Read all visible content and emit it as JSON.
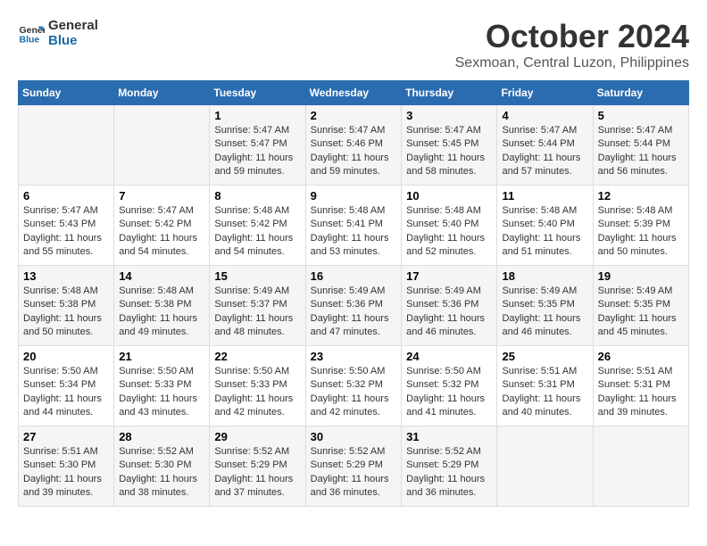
{
  "logo": {
    "line1": "General",
    "line2": "Blue"
  },
  "title": "October 2024",
  "subtitle": "Sexmoan, Central Luzon, Philippines",
  "weekdays": [
    "Sunday",
    "Monday",
    "Tuesday",
    "Wednesday",
    "Thursday",
    "Friday",
    "Saturday"
  ],
  "weeks": [
    [
      {
        "day": "",
        "sunrise": "",
        "sunset": "",
        "daylight": ""
      },
      {
        "day": "",
        "sunrise": "",
        "sunset": "",
        "daylight": ""
      },
      {
        "day": "1",
        "sunrise": "Sunrise: 5:47 AM",
        "sunset": "Sunset: 5:47 PM",
        "daylight": "Daylight: 11 hours and 59 minutes."
      },
      {
        "day": "2",
        "sunrise": "Sunrise: 5:47 AM",
        "sunset": "Sunset: 5:46 PM",
        "daylight": "Daylight: 11 hours and 59 minutes."
      },
      {
        "day": "3",
        "sunrise": "Sunrise: 5:47 AM",
        "sunset": "Sunset: 5:45 PM",
        "daylight": "Daylight: 11 hours and 58 minutes."
      },
      {
        "day": "4",
        "sunrise": "Sunrise: 5:47 AM",
        "sunset": "Sunset: 5:44 PM",
        "daylight": "Daylight: 11 hours and 57 minutes."
      },
      {
        "day": "5",
        "sunrise": "Sunrise: 5:47 AM",
        "sunset": "Sunset: 5:44 PM",
        "daylight": "Daylight: 11 hours and 56 minutes."
      }
    ],
    [
      {
        "day": "6",
        "sunrise": "Sunrise: 5:47 AM",
        "sunset": "Sunset: 5:43 PM",
        "daylight": "Daylight: 11 hours and 55 minutes."
      },
      {
        "day": "7",
        "sunrise": "Sunrise: 5:47 AM",
        "sunset": "Sunset: 5:42 PM",
        "daylight": "Daylight: 11 hours and 54 minutes."
      },
      {
        "day": "8",
        "sunrise": "Sunrise: 5:48 AM",
        "sunset": "Sunset: 5:42 PM",
        "daylight": "Daylight: 11 hours and 54 minutes."
      },
      {
        "day": "9",
        "sunrise": "Sunrise: 5:48 AM",
        "sunset": "Sunset: 5:41 PM",
        "daylight": "Daylight: 11 hours and 53 minutes."
      },
      {
        "day": "10",
        "sunrise": "Sunrise: 5:48 AM",
        "sunset": "Sunset: 5:40 PM",
        "daylight": "Daylight: 11 hours and 52 minutes."
      },
      {
        "day": "11",
        "sunrise": "Sunrise: 5:48 AM",
        "sunset": "Sunset: 5:40 PM",
        "daylight": "Daylight: 11 hours and 51 minutes."
      },
      {
        "day": "12",
        "sunrise": "Sunrise: 5:48 AM",
        "sunset": "Sunset: 5:39 PM",
        "daylight": "Daylight: 11 hours and 50 minutes."
      }
    ],
    [
      {
        "day": "13",
        "sunrise": "Sunrise: 5:48 AM",
        "sunset": "Sunset: 5:38 PM",
        "daylight": "Daylight: 11 hours and 50 minutes."
      },
      {
        "day": "14",
        "sunrise": "Sunrise: 5:48 AM",
        "sunset": "Sunset: 5:38 PM",
        "daylight": "Daylight: 11 hours and 49 minutes."
      },
      {
        "day": "15",
        "sunrise": "Sunrise: 5:49 AM",
        "sunset": "Sunset: 5:37 PM",
        "daylight": "Daylight: 11 hours and 48 minutes."
      },
      {
        "day": "16",
        "sunrise": "Sunrise: 5:49 AM",
        "sunset": "Sunset: 5:36 PM",
        "daylight": "Daylight: 11 hours and 47 minutes."
      },
      {
        "day": "17",
        "sunrise": "Sunrise: 5:49 AM",
        "sunset": "Sunset: 5:36 PM",
        "daylight": "Daylight: 11 hours and 46 minutes."
      },
      {
        "day": "18",
        "sunrise": "Sunrise: 5:49 AM",
        "sunset": "Sunset: 5:35 PM",
        "daylight": "Daylight: 11 hours and 46 minutes."
      },
      {
        "day": "19",
        "sunrise": "Sunrise: 5:49 AM",
        "sunset": "Sunset: 5:35 PM",
        "daylight": "Daylight: 11 hours and 45 minutes."
      }
    ],
    [
      {
        "day": "20",
        "sunrise": "Sunrise: 5:50 AM",
        "sunset": "Sunset: 5:34 PM",
        "daylight": "Daylight: 11 hours and 44 minutes."
      },
      {
        "day": "21",
        "sunrise": "Sunrise: 5:50 AM",
        "sunset": "Sunset: 5:33 PM",
        "daylight": "Daylight: 11 hours and 43 minutes."
      },
      {
        "day": "22",
        "sunrise": "Sunrise: 5:50 AM",
        "sunset": "Sunset: 5:33 PM",
        "daylight": "Daylight: 11 hours and 42 minutes."
      },
      {
        "day": "23",
        "sunrise": "Sunrise: 5:50 AM",
        "sunset": "Sunset: 5:32 PM",
        "daylight": "Daylight: 11 hours and 42 minutes."
      },
      {
        "day": "24",
        "sunrise": "Sunrise: 5:50 AM",
        "sunset": "Sunset: 5:32 PM",
        "daylight": "Daylight: 11 hours and 41 minutes."
      },
      {
        "day": "25",
        "sunrise": "Sunrise: 5:51 AM",
        "sunset": "Sunset: 5:31 PM",
        "daylight": "Daylight: 11 hours and 40 minutes."
      },
      {
        "day": "26",
        "sunrise": "Sunrise: 5:51 AM",
        "sunset": "Sunset: 5:31 PM",
        "daylight": "Daylight: 11 hours and 39 minutes."
      }
    ],
    [
      {
        "day": "27",
        "sunrise": "Sunrise: 5:51 AM",
        "sunset": "Sunset: 5:30 PM",
        "daylight": "Daylight: 11 hours and 39 minutes."
      },
      {
        "day": "28",
        "sunrise": "Sunrise: 5:52 AM",
        "sunset": "Sunset: 5:30 PM",
        "daylight": "Daylight: 11 hours and 38 minutes."
      },
      {
        "day": "29",
        "sunrise": "Sunrise: 5:52 AM",
        "sunset": "Sunset: 5:29 PM",
        "daylight": "Daylight: 11 hours and 37 minutes."
      },
      {
        "day": "30",
        "sunrise": "Sunrise: 5:52 AM",
        "sunset": "Sunset: 5:29 PM",
        "daylight": "Daylight: 11 hours and 36 minutes."
      },
      {
        "day": "31",
        "sunrise": "Sunrise: 5:52 AM",
        "sunset": "Sunset: 5:29 PM",
        "daylight": "Daylight: 11 hours and 36 minutes."
      },
      {
        "day": "",
        "sunrise": "",
        "sunset": "",
        "daylight": ""
      },
      {
        "day": "",
        "sunrise": "",
        "sunset": "",
        "daylight": ""
      }
    ]
  ]
}
